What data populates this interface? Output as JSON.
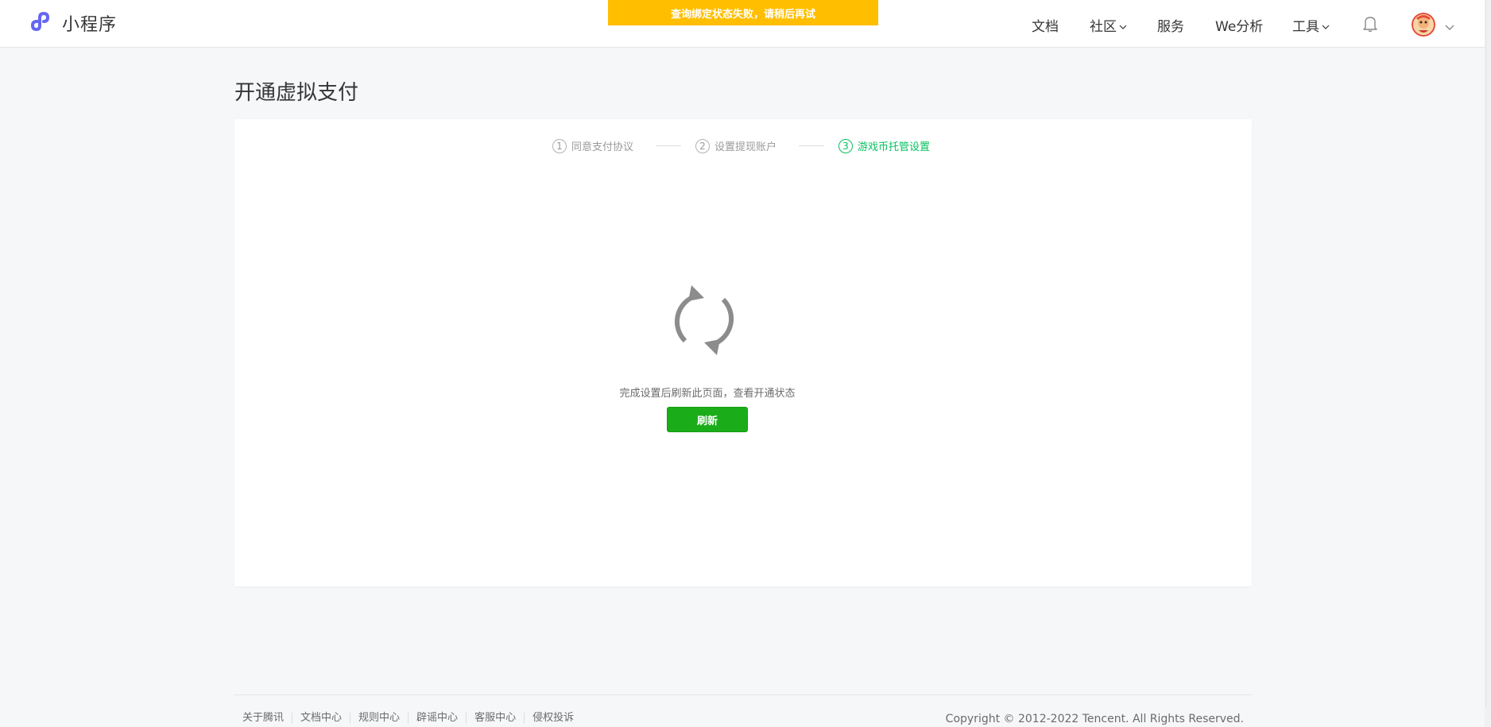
{
  "header": {
    "logo_text": "小程序",
    "nav": {
      "docs": "文档",
      "community": "社区",
      "service": "服务",
      "we_analysis": "We分析",
      "tools": "工具"
    }
  },
  "toast": {
    "message": "查询绑定状态失败，请稍后再试",
    "color": "#ffbe00"
  },
  "page": {
    "title": "开通虚拟支付"
  },
  "steps": [
    {
      "number": "1",
      "label": "同意支付协议",
      "active": false
    },
    {
      "number": "2",
      "label": "设置提现账户",
      "active": false
    },
    {
      "number": "3",
      "label": "游戏币托管设置",
      "active": true
    }
  ],
  "main": {
    "hint": "完成设置后刷新此页面，查看开通状态",
    "refresh_button": "刷新",
    "accent_color": "#1aad19"
  },
  "footer": {
    "links": [
      "关于腾讯",
      "文档中心",
      "规则中心",
      "辟谣中心",
      "客服中心",
      "侵权投诉"
    ],
    "copyright": "Copyright © 2012-2022 Tencent. All Rights Reserved."
  },
  "icons": {
    "logo": "mini-program-logo-icon",
    "bell": "bell-icon",
    "refresh": "refresh-icon",
    "chevron": "chevron-down-icon"
  }
}
